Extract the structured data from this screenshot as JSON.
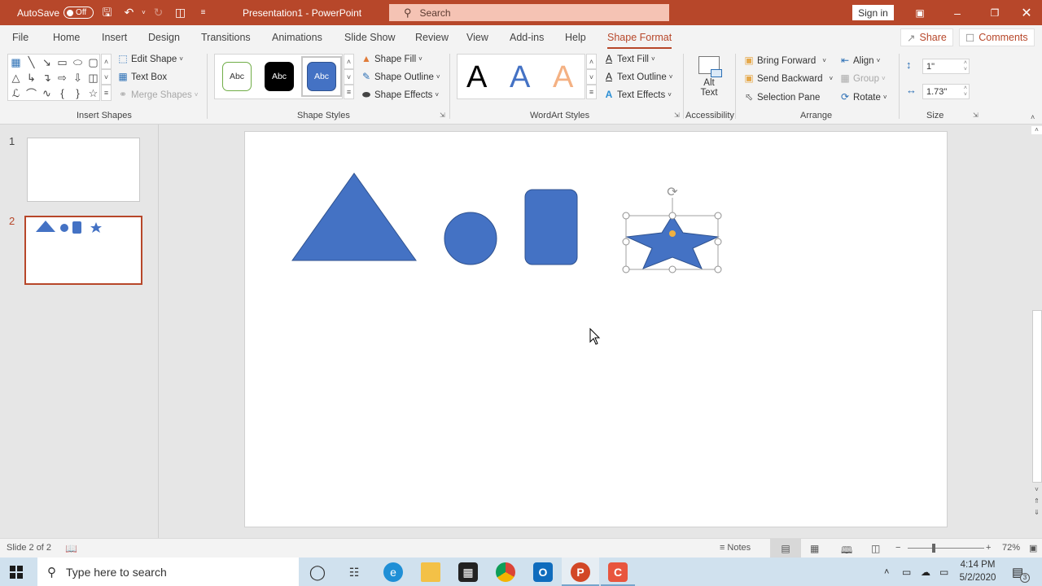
{
  "titlebar": {
    "autosave_label": "AutoSave",
    "autosave_state": "Off",
    "doc_title": "Presentation1  -  PowerPoint",
    "search_placeholder": "Search",
    "signin_label": "Sign in",
    "icons": [
      "save-icon",
      "undo-icon",
      "redo-icon",
      "start-from-beginning-icon",
      "customize-qat-icon"
    ]
  },
  "tabs": [
    "File",
    "Home",
    "Insert",
    "Design",
    "Transitions",
    "Animations",
    "Slide Show",
    "Review",
    "View",
    "Add-ins",
    "Help",
    "Shape Format"
  ],
  "active_tab": "Shape Format",
  "share_label": "Share",
  "comments_label": "Comments",
  "ribbon": {
    "insert_shapes": {
      "label": "Insert Shapes",
      "gallery": [
        "text-box",
        "line",
        "arrow",
        "rectangle",
        "oval",
        "rounded-rectangle",
        "triangle",
        "elbow-connector",
        "elbow-arrow-connector",
        "right-arrow",
        "down-arrow",
        "snip-rectangle",
        "freeform",
        "arc",
        "wave",
        "left-brace",
        "right-brace",
        "star"
      ],
      "edit_shape": "Edit Shape",
      "text_box": "Text Box",
      "merge_shapes": "Merge Shapes"
    },
    "shape_styles": {
      "label": "Shape Styles",
      "presets": [
        {
          "text": "Abc",
          "bg": "#ffffff",
          "fg": "#333333",
          "border": "#70ad47"
        },
        {
          "text": "Abc",
          "bg": "#000000",
          "fg": "#ffffff",
          "border": "#000000"
        },
        {
          "text": "Abc",
          "bg": "#4472c4",
          "fg": "#ffffff",
          "border": "#2f528f"
        }
      ],
      "shape_fill": "Shape Fill",
      "shape_outline": "Shape Outline",
      "shape_effects": "Shape Effects"
    },
    "wordart": {
      "label": "WordArt Styles",
      "presets": [
        {
          "text": "A",
          "color": "#000000"
        },
        {
          "text": "A",
          "color": "#4472c4"
        },
        {
          "text": "A",
          "color": "#f4b183"
        }
      ],
      "text_fill": "Text Fill",
      "text_outline": "Text Outline",
      "text_effects": "Text Effects"
    },
    "accessibility": {
      "label": "Accessibility",
      "alt_text_1": "Alt",
      "alt_text_2": "Text"
    },
    "arrange": {
      "label": "Arrange",
      "bring_forward": "Bring Forward",
      "send_backward": "Send Backward",
      "selection_pane": "Selection Pane",
      "align": "Align",
      "group": "Group",
      "rotate": "Rotate"
    },
    "size": {
      "label": "Size",
      "height": "1\"",
      "width": "1.73\""
    }
  },
  "slides": [
    {
      "number": "1",
      "selected": false
    },
    {
      "number": "2",
      "selected": true
    }
  ],
  "canvas": {
    "shape_color": "#4472c4",
    "shapes": [
      "triangle",
      "circle",
      "rounded-rectangle",
      "star"
    ],
    "selected_shape": "star"
  },
  "status": {
    "slide_info": "Slide 2 of 2",
    "notes_label": "Notes",
    "zoom_minus": "−",
    "zoom_plus": "+",
    "zoom_level": "72%"
  },
  "taskbar": {
    "search_placeholder": "Type here to search",
    "apps": [
      "cortana",
      "task-view",
      "edge",
      "file-explorer",
      "store",
      "chrome",
      "outlook",
      "powerpoint",
      "camtasia"
    ],
    "time": "4:14 PM",
    "date": "5/2/2020",
    "notification_count": "3"
  },
  "colors": {
    "accent": "#b7472a",
    "shape": "#4472c4"
  }
}
